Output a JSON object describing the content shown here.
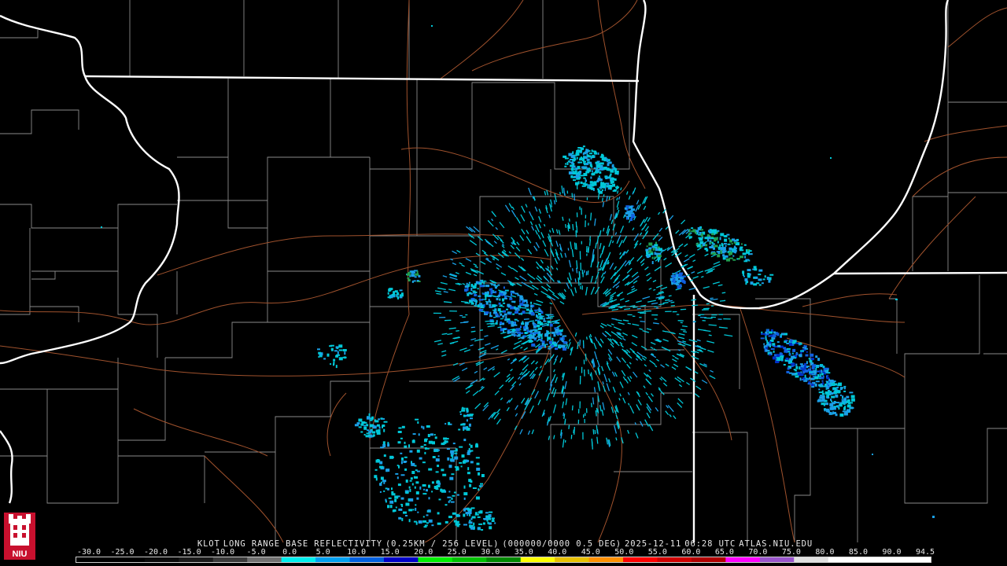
{
  "caption": {
    "radar": "KLOT",
    "product": "LONG RANGE BASE REFLECTIVITY",
    "resolution": "(0.25KM / 256 LEVEL)",
    "elevation": "(000000/0000 0.5 DEG)",
    "date": "2025-12-11",
    "time": "06:28 UTC",
    "source": "ATLAS.NIU.EDU"
  },
  "logo": {
    "text": "NIU",
    "icon": "niu-tower-logo-icon",
    "color": "#c8102e"
  },
  "scale": {
    "labels": [
      "-30.0",
      "-25.0",
      "-20.0",
      "-15.0",
      "-10.0",
      "-5.0",
      "0.0",
      "5.0",
      "10.0",
      "15.0",
      "20.0",
      "25.0",
      "30.0",
      "35.0",
      "40.0",
      "45.0",
      "50.0",
      "55.0",
      "60.0",
      "65.0",
      "70.0",
      "75.0",
      "80.0",
      "85.0",
      "90.0",
      "94.5"
    ],
    "colors": [
      "#000000",
      "#000000",
      "#0a0a0a",
      "#1a1a1a",
      "#3a3a3a",
      "#707070",
      "#00eeee",
      "#00a0f0",
      "#0060e0",
      "#0000c8",
      "#00f000",
      "#00c000",
      "#008800",
      "#ffff00",
      "#e7c000",
      "#ff9000",
      "#ff0000",
      "#d00000",
      "#b00000",
      "#ff00ff",
      "#9955cc",
      "#e0e0e0",
      "#ffffff",
      "#ffffff",
      "#ffffff"
    ]
  },
  "map": {
    "background": "#000000",
    "state_border_color": "#ffffff",
    "county_border_color": "#8a8a8a",
    "highway_color": "#a0522d",
    "echo_colors": [
      "#00c8d8",
      "#1aa0e8",
      "#1060e0",
      "#0030c8",
      "#20a050"
    ]
  }
}
